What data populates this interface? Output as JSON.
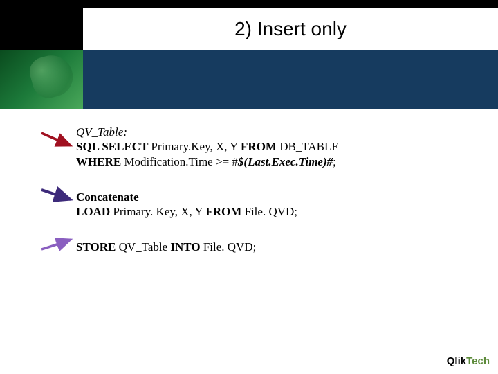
{
  "title": "2) Insert only",
  "block1": {
    "line1_label": "QV_Table:",
    "line2_prefix": "SQL SELECT ",
    "line2_mid": "Primary.Key, X, Y ",
    "line2_from": "FROM ",
    "line2_table": "DB_TABLE",
    "line3_where": "WHERE ",
    "line3_cond_a": "Modification.Time >= #",
    "line3_cond_b": "$(Last.Exec.Time)#",
    "line3_cond_c": ";"
  },
  "block2": {
    "line1": "Concatenate",
    "line2_load": "LOAD ",
    "line2_mid": "Primary. Key, X, Y ",
    "line2_from": "FROM ",
    "line2_file": "File. QVD;"
  },
  "block3": {
    "line1_store": "STORE ",
    "line1_mid": "QV_Table ",
    "line1_into": "INTO ",
    "line1_file": "File. QVD;"
  },
  "logo": {
    "part1": "Qlik",
    "part2": "Tech"
  },
  "arrows": {
    "a1_color": "#a01020",
    "a2_color": "#3d2a7a",
    "a3_color": "#8a5fc0"
  }
}
